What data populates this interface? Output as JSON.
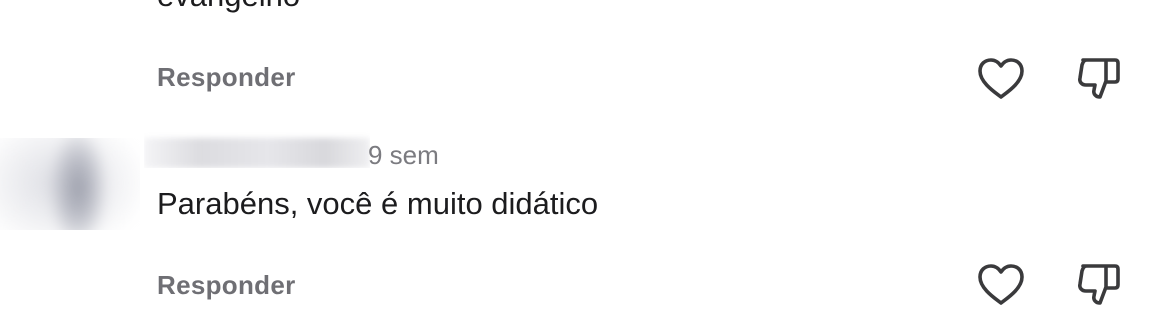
{
  "previous_comment": {
    "text_fragment": "evangelho",
    "reply_label": "Responder"
  },
  "comment": {
    "time": "9 sem",
    "text": "Parabéns, você é muito didático",
    "reply_label": "Responder"
  },
  "icons": {
    "like": "heart-icon",
    "dislike": "thumbs-down-icon"
  },
  "colors": {
    "text": "#1c1c1e",
    "secondary": "#6f6f74",
    "icon": "#3a3a3c"
  }
}
